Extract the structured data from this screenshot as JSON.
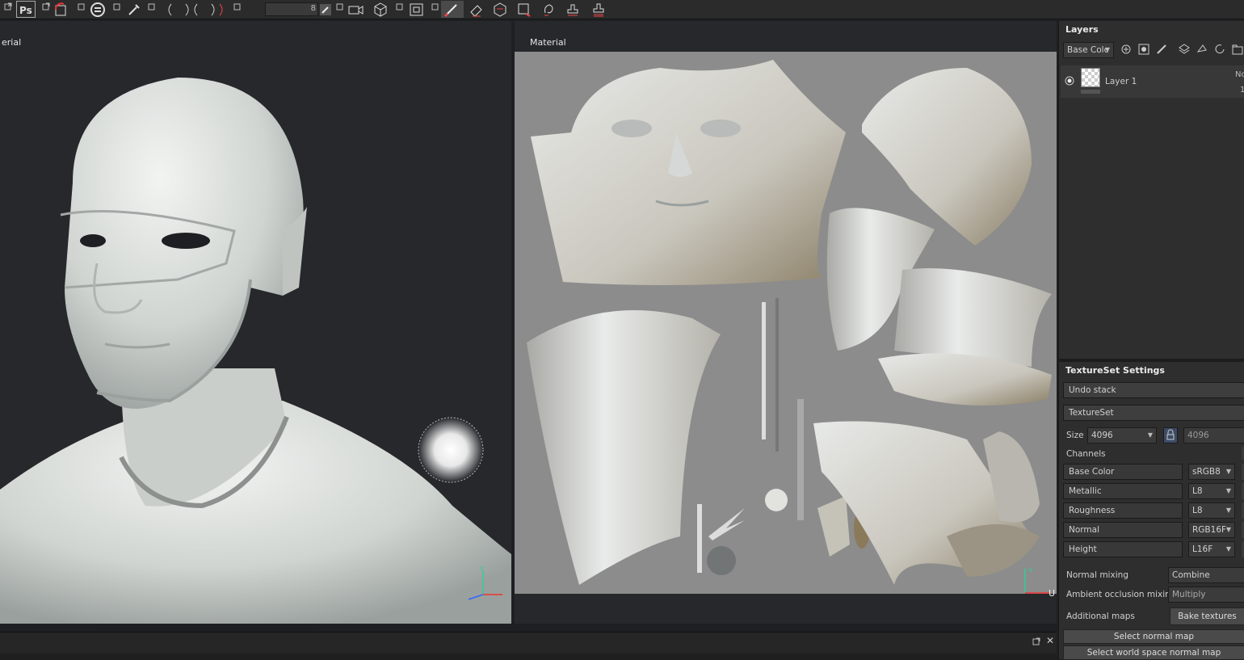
{
  "toolbar": {
    "brush_size": "8",
    "icons": [
      "external-link-icon",
      "photoshop-icon",
      "export-icon",
      "substance-logo-icon",
      "eyedropper-icon",
      "symmetry-icon",
      "camera-icon",
      "cube-icon",
      "uv-icon",
      "paint-brush-icon",
      "eraser-icon",
      "projection-icon",
      "polygon-fill-icon",
      "smudge-icon",
      "clone-stamp-icon",
      "bake-stamp-icon"
    ]
  },
  "viewport3d": {
    "label": "erial"
  },
  "viewport2d": {
    "label": "Material"
  },
  "layers": {
    "title": "Layers",
    "channel_select": "Base Colc",
    "items": [
      {
        "name": "Layer 1",
        "blend": "No",
        "opacity": "1"
      }
    ]
  },
  "textureset": {
    "title": "TextureSet Settings",
    "undo_stack": "Undo stack",
    "textureset_label": "TextureSet",
    "size_label": "Size",
    "size_value": "4096",
    "size_value2": "4096",
    "channels_label": "Channels",
    "channels": [
      {
        "name": "Base Color",
        "format": "sRGB8"
      },
      {
        "name": "Metallic",
        "format": "L8"
      },
      {
        "name": "Roughness",
        "format": "L8"
      },
      {
        "name": "Normal",
        "format": "RGB16F"
      },
      {
        "name": "Height",
        "format": "L16F"
      }
    ],
    "normal_mixing_label": "Normal mixing",
    "normal_mixing_value": "Combine",
    "ao_mixing_label": "Ambient occlusion mixing",
    "ao_mixing_value": "Multiply",
    "additional_maps_label": "Additional maps",
    "bake_textures": "Bake textures",
    "select_normal_map": "Select normal map",
    "select_world_space_normal_map": "Select world space normal map"
  },
  "colors": {
    "panel_bg": "#2e2e2e",
    "viewport_bg": "#26282c",
    "uv_bg": "#8c8c8c",
    "toolbar_bg": "#2b2b2b"
  }
}
